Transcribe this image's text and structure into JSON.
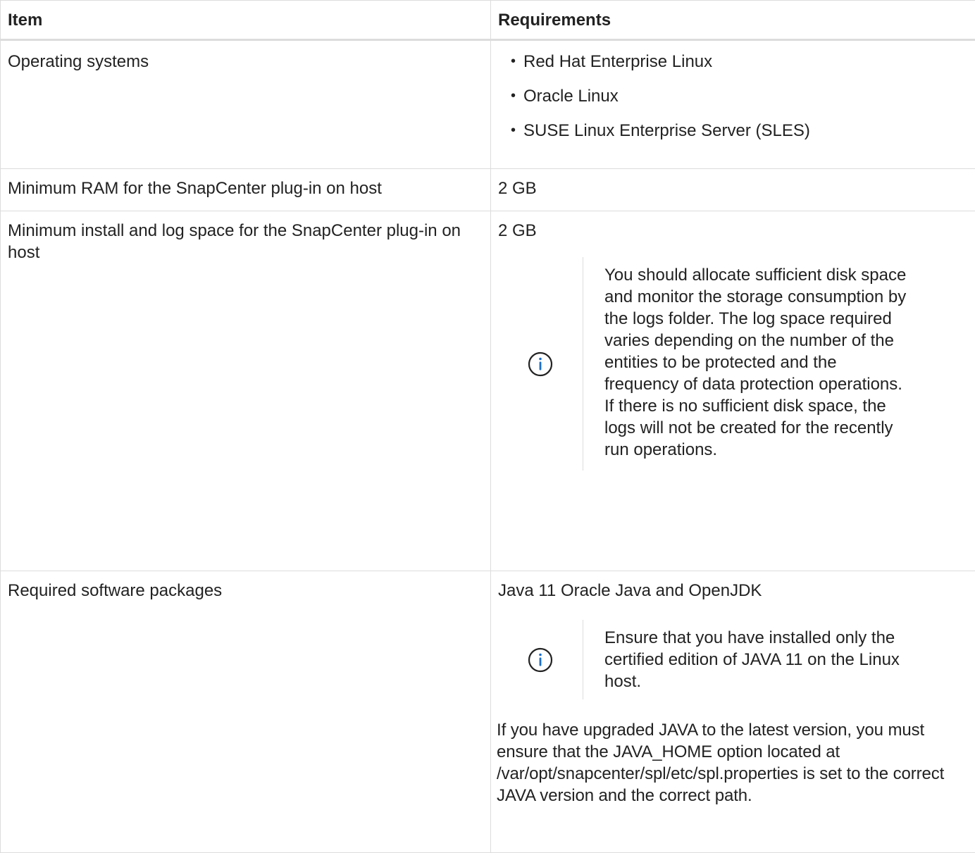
{
  "table": {
    "headers": {
      "item": "Item",
      "requirements": "Requirements"
    },
    "rows": {
      "os": {
        "item": "Operating systems",
        "list": [
          "Red Hat Enterprise Linux",
          "Oracle Linux",
          "SUSE Linux Enterprise Server (SLES)"
        ]
      },
      "ram": {
        "item": "Minimum RAM for the SnapCenter plug-in on host",
        "value": "2 GB"
      },
      "space": {
        "item": "Minimum install and log space for the SnapCenter plug-in on host",
        "value": "2 GB",
        "note": "You should allocate sufficient disk space and monitor the storage consumption by the logs folder. The log space required varies depending on the number of the entities to be protected and the frequency of data protection operations. If there is no sufficient disk space, the logs will not be created for the recently run operations."
      },
      "packages": {
        "item": "Required software packages",
        "value": "Java 11 Oracle Java and OpenJDK",
        "note": "Ensure that you have installed only the certified edition of JAVA 11 on the Linux host.",
        "after": "If you have upgraded JAVA to the latest version, you must ensure that the JAVA_HOME option located at /var/opt/snapcenter/spl/etc/spl.properties is set to the correct JAVA version and the correct path."
      }
    }
  },
  "colors": {
    "border": "#dcdcdc",
    "text": "#222222",
    "icon": "#1a6fc9"
  },
  "icons": {
    "note_icon": "info-circle-icon"
  }
}
